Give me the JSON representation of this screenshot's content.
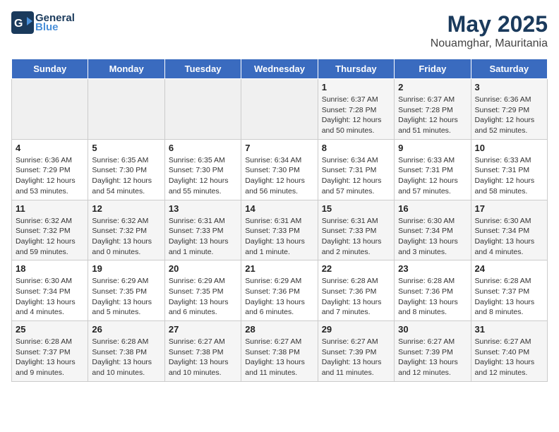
{
  "header": {
    "logo_line1": "General",
    "logo_line2": "Blue",
    "month": "May 2025",
    "location": "Nouamghar, Mauritania"
  },
  "weekdays": [
    "Sunday",
    "Monday",
    "Tuesday",
    "Wednesday",
    "Thursday",
    "Friday",
    "Saturday"
  ],
  "weeks": [
    [
      {
        "day": "",
        "info": ""
      },
      {
        "day": "",
        "info": ""
      },
      {
        "day": "",
        "info": ""
      },
      {
        "day": "",
        "info": ""
      },
      {
        "day": "1",
        "info": "Sunrise: 6:37 AM\nSunset: 7:28 PM\nDaylight: 12 hours and 50 minutes."
      },
      {
        "day": "2",
        "info": "Sunrise: 6:37 AM\nSunset: 7:28 PM\nDaylight: 12 hours and 51 minutes."
      },
      {
        "day": "3",
        "info": "Sunrise: 6:36 AM\nSunset: 7:29 PM\nDaylight: 12 hours and 52 minutes."
      }
    ],
    [
      {
        "day": "4",
        "info": "Sunrise: 6:36 AM\nSunset: 7:29 PM\nDaylight: 12 hours and 53 minutes."
      },
      {
        "day": "5",
        "info": "Sunrise: 6:35 AM\nSunset: 7:30 PM\nDaylight: 12 hours and 54 minutes."
      },
      {
        "day": "6",
        "info": "Sunrise: 6:35 AM\nSunset: 7:30 PM\nDaylight: 12 hours and 55 minutes."
      },
      {
        "day": "7",
        "info": "Sunrise: 6:34 AM\nSunset: 7:30 PM\nDaylight: 12 hours and 56 minutes."
      },
      {
        "day": "8",
        "info": "Sunrise: 6:34 AM\nSunset: 7:31 PM\nDaylight: 12 hours and 57 minutes."
      },
      {
        "day": "9",
        "info": "Sunrise: 6:33 AM\nSunset: 7:31 PM\nDaylight: 12 hours and 57 minutes."
      },
      {
        "day": "10",
        "info": "Sunrise: 6:33 AM\nSunset: 7:31 PM\nDaylight: 12 hours and 58 minutes."
      }
    ],
    [
      {
        "day": "11",
        "info": "Sunrise: 6:32 AM\nSunset: 7:32 PM\nDaylight: 12 hours and 59 minutes."
      },
      {
        "day": "12",
        "info": "Sunrise: 6:32 AM\nSunset: 7:32 PM\nDaylight: 13 hours and 0 minutes."
      },
      {
        "day": "13",
        "info": "Sunrise: 6:31 AM\nSunset: 7:33 PM\nDaylight: 13 hours and 1 minute."
      },
      {
        "day": "14",
        "info": "Sunrise: 6:31 AM\nSunset: 7:33 PM\nDaylight: 13 hours and 1 minute."
      },
      {
        "day": "15",
        "info": "Sunrise: 6:31 AM\nSunset: 7:33 PM\nDaylight: 13 hours and 2 minutes."
      },
      {
        "day": "16",
        "info": "Sunrise: 6:30 AM\nSunset: 7:34 PM\nDaylight: 13 hours and 3 minutes."
      },
      {
        "day": "17",
        "info": "Sunrise: 6:30 AM\nSunset: 7:34 PM\nDaylight: 13 hours and 4 minutes."
      }
    ],
    [
      {
        "day": "18",
        "info": "Sunrise: 6:30 AM\nSunset: 7:34 PM\nDaylight: 13 hours and 4 minutes."
      },
      {
        "day": "19",
        "info": "Sunrise: 6:29 AM\nSunset: 7:35 PM\nDaylight: 13 hours and 5 minutes."
      },
      {
        "day": "20",
        "info": "Sunrise: 6:29 AM\nSunset: 7:35 PM\nDaylight: 13 hours and 6 minutes."
      },
      {
        "day": "21",
        "info": "Sunrise: 6:29 AM\nSunset: 7:36 PM\nDaylight: 13 hours and 6 minutes."
      },
      {
        "day": "22",
        "info": "Sunrise: 6:28 AM\nSunset: 7:36 PM\nDaylight: 13 hours and 7 minutes."
      },
      {
        "day": "23",
        "info": "Sunrise: 6:28 AM\nSunset: 7:36 PM\nDaylight: 13 hours and 8 minutes."
      },
      {
        "day": "24",
        "info": "Sunrise: 6:28 AM\nSunset: 7:37 PM\nDaylight: 13 hours and 8 minutes."
      }
    ],
    [
      {
        "day": "25",
        "info": "Sunrise: 6:28 AM\nSunset: 7:37 PM\nDaylight: 13 hours and 9 minutes."
      },
      {
        "day": "26",
        "info": "Sunrise: 6:28 AM\nSunset: 7:38 PM\nDaylight: 13 hours and 10 minutes."
      },
      {
        "day": "27",
        "info": "Sunrise: 6:27 AM\nSunset: 7:38 PM\nDaylight: 13 hours and 10 minutes."
      },
      {
        "day": "28",
        "info": "Sunrise: 6:27 AM\nSunset: 7:38 PM\nDaylight: 13 hours and 11 minutes."
      },
      {
        "day": "29",
        "info": "Sunrise: 6:27 AM\nSunset: 7:39 PM\nDaylight: 13 hours and 11 minutes."
      },
      {
        "day": "30",
        "info": "Sunrise: 6:27 AM\nSunset: 7:39 PM\nDaylight: 13 hours and 12 minutes."
      },
      {
        "day": "31",
        "info": "Sunrise: 6:27 AM\nSunset: 7:40 PM\nDaylight: 13 hours and 12 minutes."
      }
    ]
  ]
}
